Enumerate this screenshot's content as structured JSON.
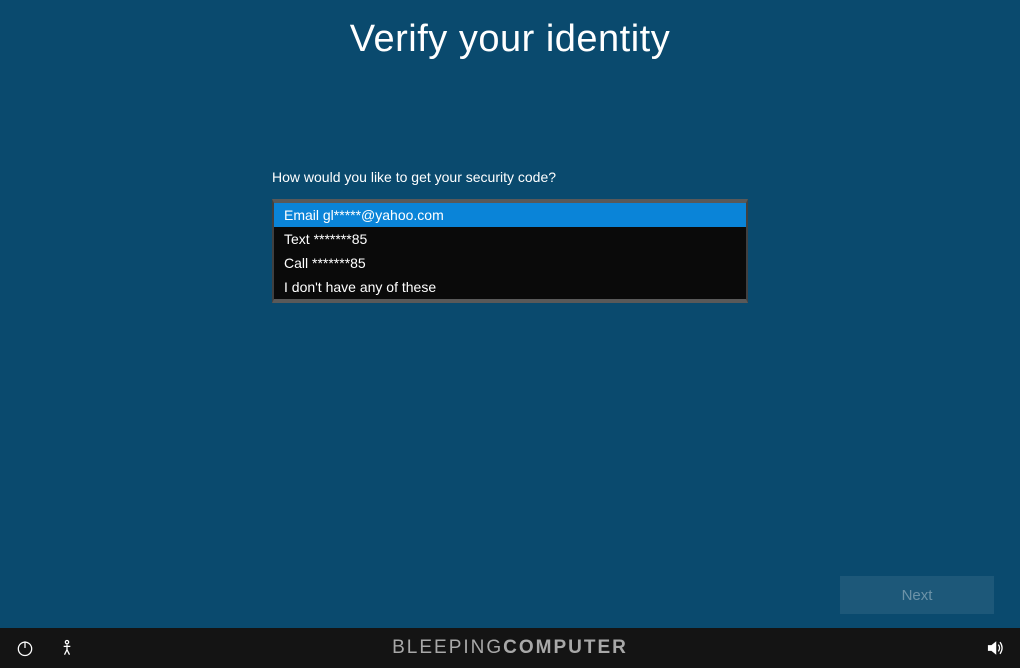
{
  "title": "Verify your identity",
  "prompt": "How would you like to get your security code?",
  "options": [
    "Email gl*****@yahoo.com",
    "Text *******85",
    "Call *******85",
    "I don't have any of these"
  ],
  "next_button": "Next",
  "watermark_left": "BLEEPING",
  "watermark_right": "COMPUTER"
}
